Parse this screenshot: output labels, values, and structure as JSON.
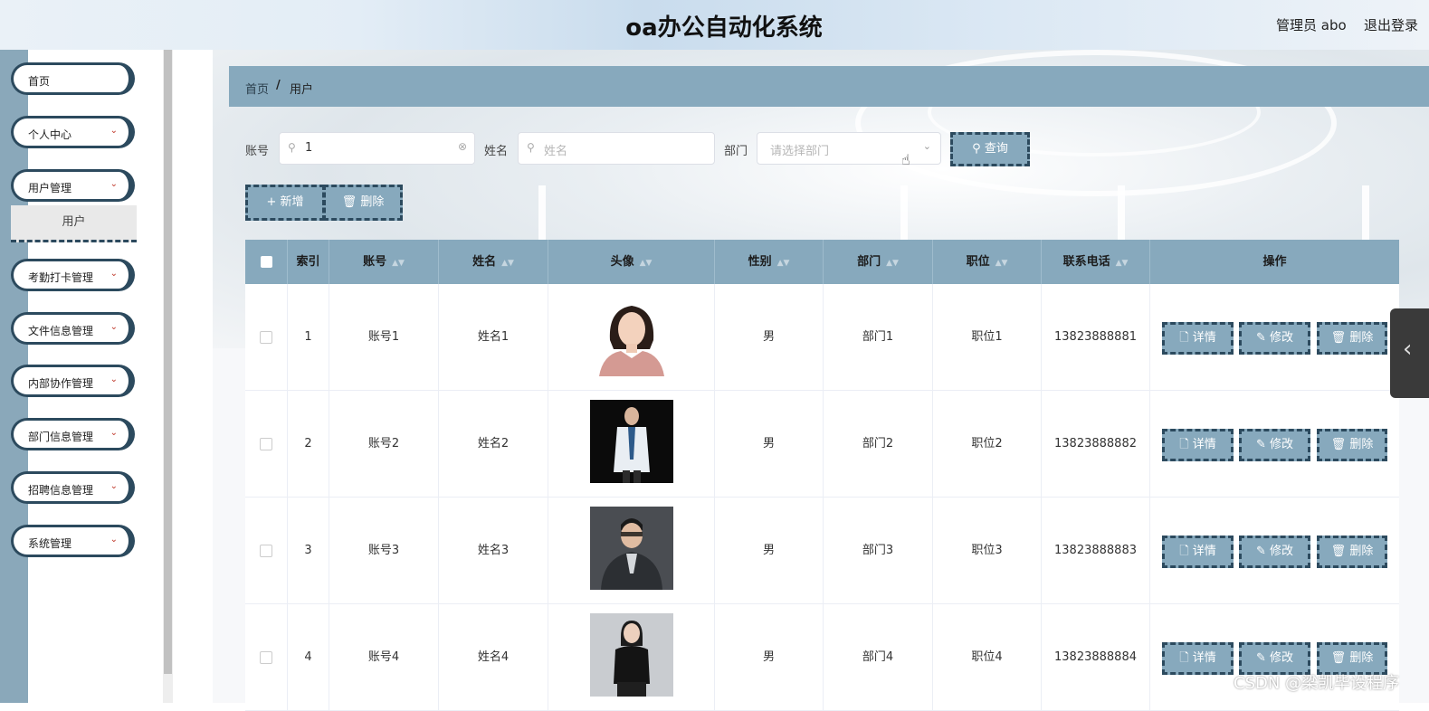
{
  "header": {
    "title": "oa办公自动化系统",
    "user": "管理员 abo",
    "logout": "退出登录"
  },
  "sidebar": {
    "items": [
      {
        "label": "首页",
        "icon": ""
      },
      {
        "label": "个人中心",
        "icon": "chevron-down-icon"
      },
      {
        "label": "用户管理",
        "icon": "chevron-down-icon"
      },
      {
        "label": "考勤打卡管理",
        "icon": "chevron-down-icon"
      },
      {
        "label": "文件信息管理",
        "icon": "chevron-down-icon"
      },
      {
        "label": "内部协作管理",
        "icon": "chevron-down-icon"
      },
      {
        "label": "部门信息管理",
        "icon": "chevron-down-icon"
      },
      {
        "label": "招聘信息管理",
        "icon": "chevron-down-icon"
      },
      {
        "label": "系统管理",
        "icon": "chevron-down-icon"
      }
    ],
    "submenu": "用户"
  },
  "breadcrumb": {
    "home": "首页",
    "separator": "/",
    "current": "用户"
  },
  "search": {
    "account_label": "账号",
    "account_value": "1",
    "name_label": "姓名",
    "name_placeholder": "姓名",
    "dept_label": "部门",
    "dept_placeholder": "请选择部门",
    "query_button": "查询"
  },
  "actions": {
    "add": "新增",
    "delete": "删除"
  },
  "table": {
    "columns": [
      "索引",
      "账号",
      "姓名",
      "头像",
      "性别",
      "部门",
      "职位",
      "联系电话",
      "操作"
    ],
    "ops": [
      "详情",
      "修改",
      "删除"
    ],
    "rows": [
      {
        "index": "1",
        "account": "账号1",
        "name": "姓名1",
        "gender": "男",
        "dept": "部门1",
        "position": "职位1",
        "phone": "13823888881"
      },
      {
        "index": "2",
        "account": "账号2",
        "name": "姓名2",
        "gender": "男",
        "dept": "部门2",
        "position": "职位2",
        "phone": "13823888882"
      },
      {
        "index": "3",
        "account": "账号3",
        "name": "姓名3",
        "gender": "男",
        "dept": "部门3",
        "position": "职位3",
        "phone": "13823888883"
      },
      {
        "index": "4",
        "account": "账号4",
        "name": "姓名4",
        "gender": "男",
        "dept": "部门4",
        "position": "职位4",
        "phone": "13823888884"
      }
    ]
  },
  "watermark": "CSDN @梁凯毕设程序",
  "colors": {
    "accent": "#87a9bd",
    "dark": "#2c4a5e",
    "sidebar_strip": "#8aa8ba"
  }
}
